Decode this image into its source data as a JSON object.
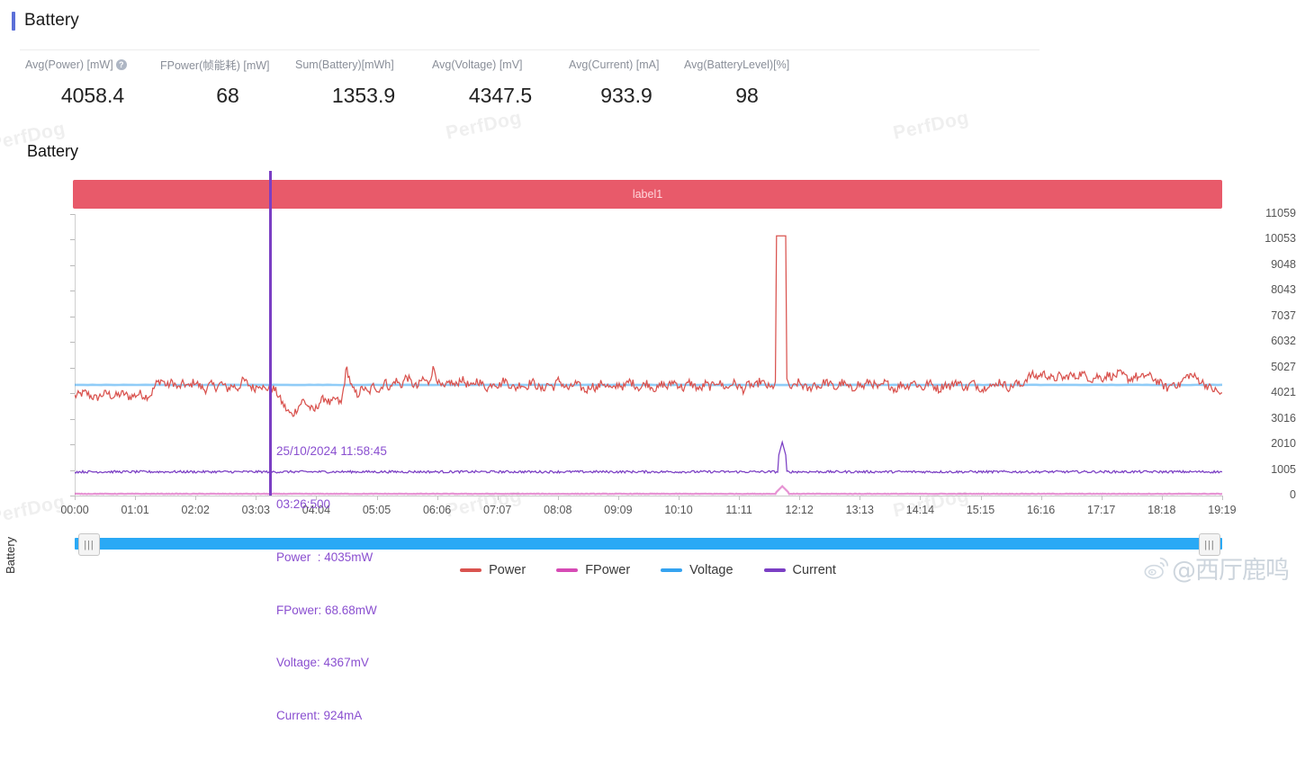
{
  "header": {
    "title": "Battery"
  },
  "metrics": [
    {
      "label": "Avg(Power) [mW]",
      "value": "4058.4",
      "has_help_icon": true
    },
    {
      "label": "FPower(帧能耗) [mW]",
      "value": "68",
      "has_help_icon": false
    },
    {
      "label": "Sum(Battery)[mWh]",
      "value": "1353.9",
      "has_help_icon": false
    },
    {
      "label": "Avg(Voltage) [mV]",
      "value": "4347.5",
      "has_help_icon": false
    },
    {
      "label": "Avg(Current) [mA]",
      "value": "933.9",
      "has_help_icon": false
    },
    {
      "label": "Avg(BatteryLevel)[%]",
      "value": "98",
      "has_help_icon": false
    }
  ],
  "chart_section": {
    "title": "Battery",
    "label_band": "label1"
  },
  "tooltip": {
    "date_time": "25/10/2024 11:58:45",
    "elapsed": "03:26:500",
    "power": "Power  : 4035mW",
    "fpower": "FPower: 68.68mW",
    "voltage": "Voltage: 4367mV",
    "current": "Current: 924mA"
  },
  "scrollbar": {
    "left_handle_icon": "grip-handle-icon",
    "right_handle_icon": "grip-handle-icon",
    "grip_glyph": "⦀"
  },
  "watermark": {
    "text": "PerfDog",
    "weibo_handle": "@西厅鹿鸣"
  },
  "colors": {
    "power": "#d9534f",
    "fpower": "#d64bb5",
    "voltage": "#35a3f0",
    "current": "#7b3fc4",
    "label_band": "#e85a6a",
    "scrollbar": "#2aa9f5",
    "title_accent": "#5b6fd8"
  },
  "chart_data": {
    "type": "line",
    "title": "Battery",
    "xlabel": "",
    "ylabel": "Battery",
    "ylim": [
      0,
      11059
    ],
    "grid": false,
    "legend_position": "bottom",
    "y_ticks": [
      0,
      1005,
      2010,
      3016,
      4021,
      5027,
      6032,
      7037,
      8043,
      9048,
      10053,
      11059
    ],
    "y_tick_labels": [
      "0",
      "1005",
      "2010",
      "3016",
      "4021",
      "5027",
      "6032",
      "7037",
      "8043",
      "9048",
      "10053",
      "11059"
    ],
    "x_tick_labels": [
      "00:00",
      "01:01",
      "02:02",
      "03:03",
      "04:04",
      "05:05",
      "06:06",
      "07:07",
      "08:08",
      "09:09",
      "10:10",
      "11:11",
      "12:12",
      "13:13",
      "14:14",
      "15:15",
      "16:16",
      "17:17",
      "18:18",
      "19:19"
    ],
    "annotations": [
      {
        "type": "cursor",
        "x_label": "03:26:500",
        "color": "#7b3fc4"
      },
      {
        "type": "band",
        "label": "label1",
        "color": "#e85a6a"
      }
    ],
    "series": [
      {
        "name": "Power",
        "unit": "mW",
        "color": "#d9534f",
        "values": [
          3900,
          3980,
          4050,
          3900,
          3820,
          3960,
          4030,
          3880,
          3950,
          4020,
          3870,
          3930,
          4010,
          3890,
          3960,
          4400,
          4550,
          4300,
          4480,
          4200,
          4420,
          4250,
          4500,
          4300,
          4150,
          4380,
          4250,
          4420,
          4180,
          4330,
          4200,
          4550,
          4350,
          4200,
          4400,
          4150,
          4300,
          4100,
          3700,
          3350,
          3150,
          3450,
          3750,
          3500,
          3300,
          3650,
          3850,
          3600,
          3800,
          3600,
          5030,
          4200,
          3950,
          4250,
          4000,
          4350,
          4100,
          4500,
          4200,
          4550,
          4300,
          4700,
          4400,
          4250,
          4600,
          4400,
          5030,
          4350,
          4200,
          4500,
          4300,
          4600,
          4400,
          4250,
          4550,
          4350,
          4200,
          4480,
          4300,
          4550,
          4350,
          4200,
          4400,
          4250,
          4500,
          4300,
          4150,
          4400,
          4250,
          4550,
          4300,
          4180,
          4420,
          4270,
          4100,
          4350,
          4200,
          4450,
          4300,
          4150,
          4400,
          4250,
          4500,
          4350,
          4200,
          4450,
          4300,
          4150,
          4400,
          4250,
          4500,
          4350,
          4200,
          4450,
          4300,
          4150,
          4400,
          4250,
          4500,
          4350,
          4200,
          4450,
          4300,
          4150,
          4400,
          4250,
          4500,
          4350,
          4200,
          4450,
          10200,
          4350,
          4200,
          4450,
          4300,
          4150,
          4400,
          4250,
          4500,
          4350,
          4200,
          4450,
          4300,
          4150,
          4400,
          4250,
          4500,
          4350,
          4200,
          4450,
          4300,
          4150,
          4400,
          4250,
          4500,
          4350,
          4200,
          4450,
          4300,
          4150,
          4400,
          4250,
          4500,
          4350,
          4200,
          4450,
          4300,
          4150,
          4400,
          4250,
          4500,
          4350,
          4200,
          4450,
          4300,
          4600,
          4750,
          4650,
          4800,
          4700,
          4550,
          4700,
          4600,
          4750,
          4650,
          4800,
          4700,
          4550,
          4700,
          4600,
          4750,
          4650,
          4800,
          4700,
          4550,
          4700,
          4600,
          4750,
          4650,
          4500,
          4350,
          4200,
          4450,
          4300,
          4600,
          4750,
          4650,
          4500,
          4350,
          4200,
          4100,
          3950
        ],
        "avg": 4058.4
      },
      {
        "name": "FPower",
        "unit": "mW",
        "color": "#d64bb5",
        "constant_approx": 68,
        "avg": 68
      },
      {
        "name": "Voltage",
        "unit": "mV",
        "color": "#35a3f0",
        "constant_approx": 4347.5,
        "avg": 4347.5
      },
      {
        "name": "Current",
        "unit": "mA",
        "color": "#7b3fc4",
        "constant_approx": 933.9,
        "spike_peak": 2100,
        "avg": 933.9
      }
    ]
  },
  "legend": [
    {
      "label": "Power",
      "color": "#d9534f"
    },
    {
      "label": "FPower",
      "color": "#d64bb5"
    },
    {
      "label": "Voltage",
      "color": "#35a3f0"
    },
    {
      "label": "Current",
      "color": "#7b3fc4"
    }
  ]
}
